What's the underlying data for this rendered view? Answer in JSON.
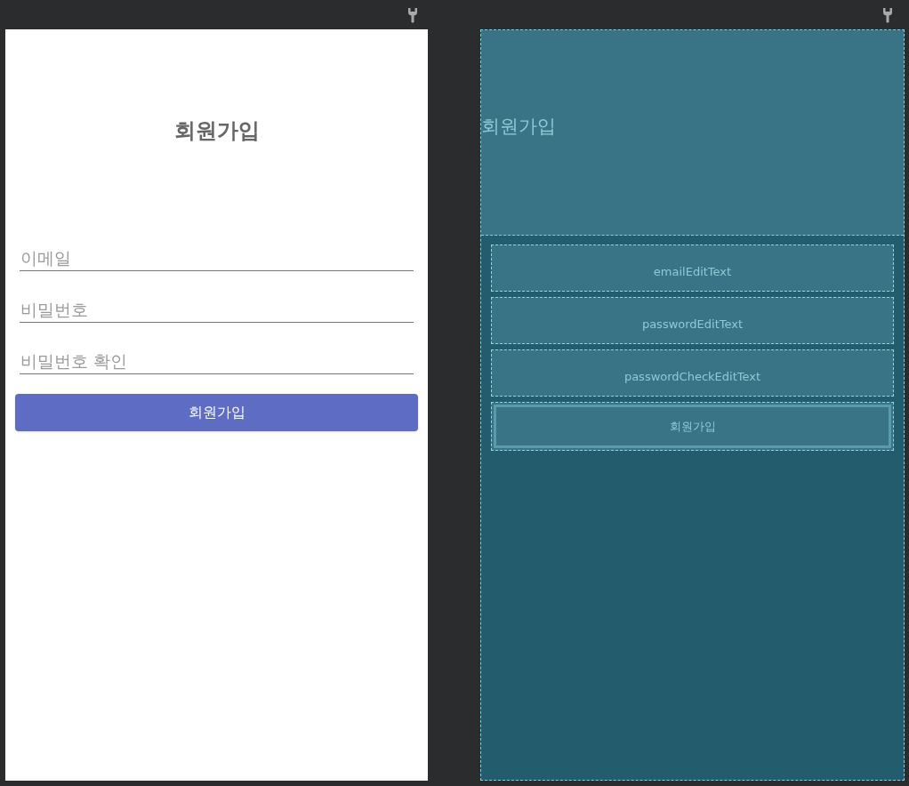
{
  "design": {
    "title": "회원가입",
    "fields": [
      {
        "placeholder": "이메일"
      },
      {
        "placeholder": "비밀번호"
      },
      {
        "placeholder": "비밀번호 확인"
      }
    ],
    "button": "회원가입"
  },
  "blueprint": {
    "title": "회원가입",
    "fields": [
      {
        "label": "emailEditText"
      },
      {
        "label": "passwordEditText"
      },
      {
        "label": "passwordCheckEditText"
      }
    ],
    "button": "회원가입"
  }
}
